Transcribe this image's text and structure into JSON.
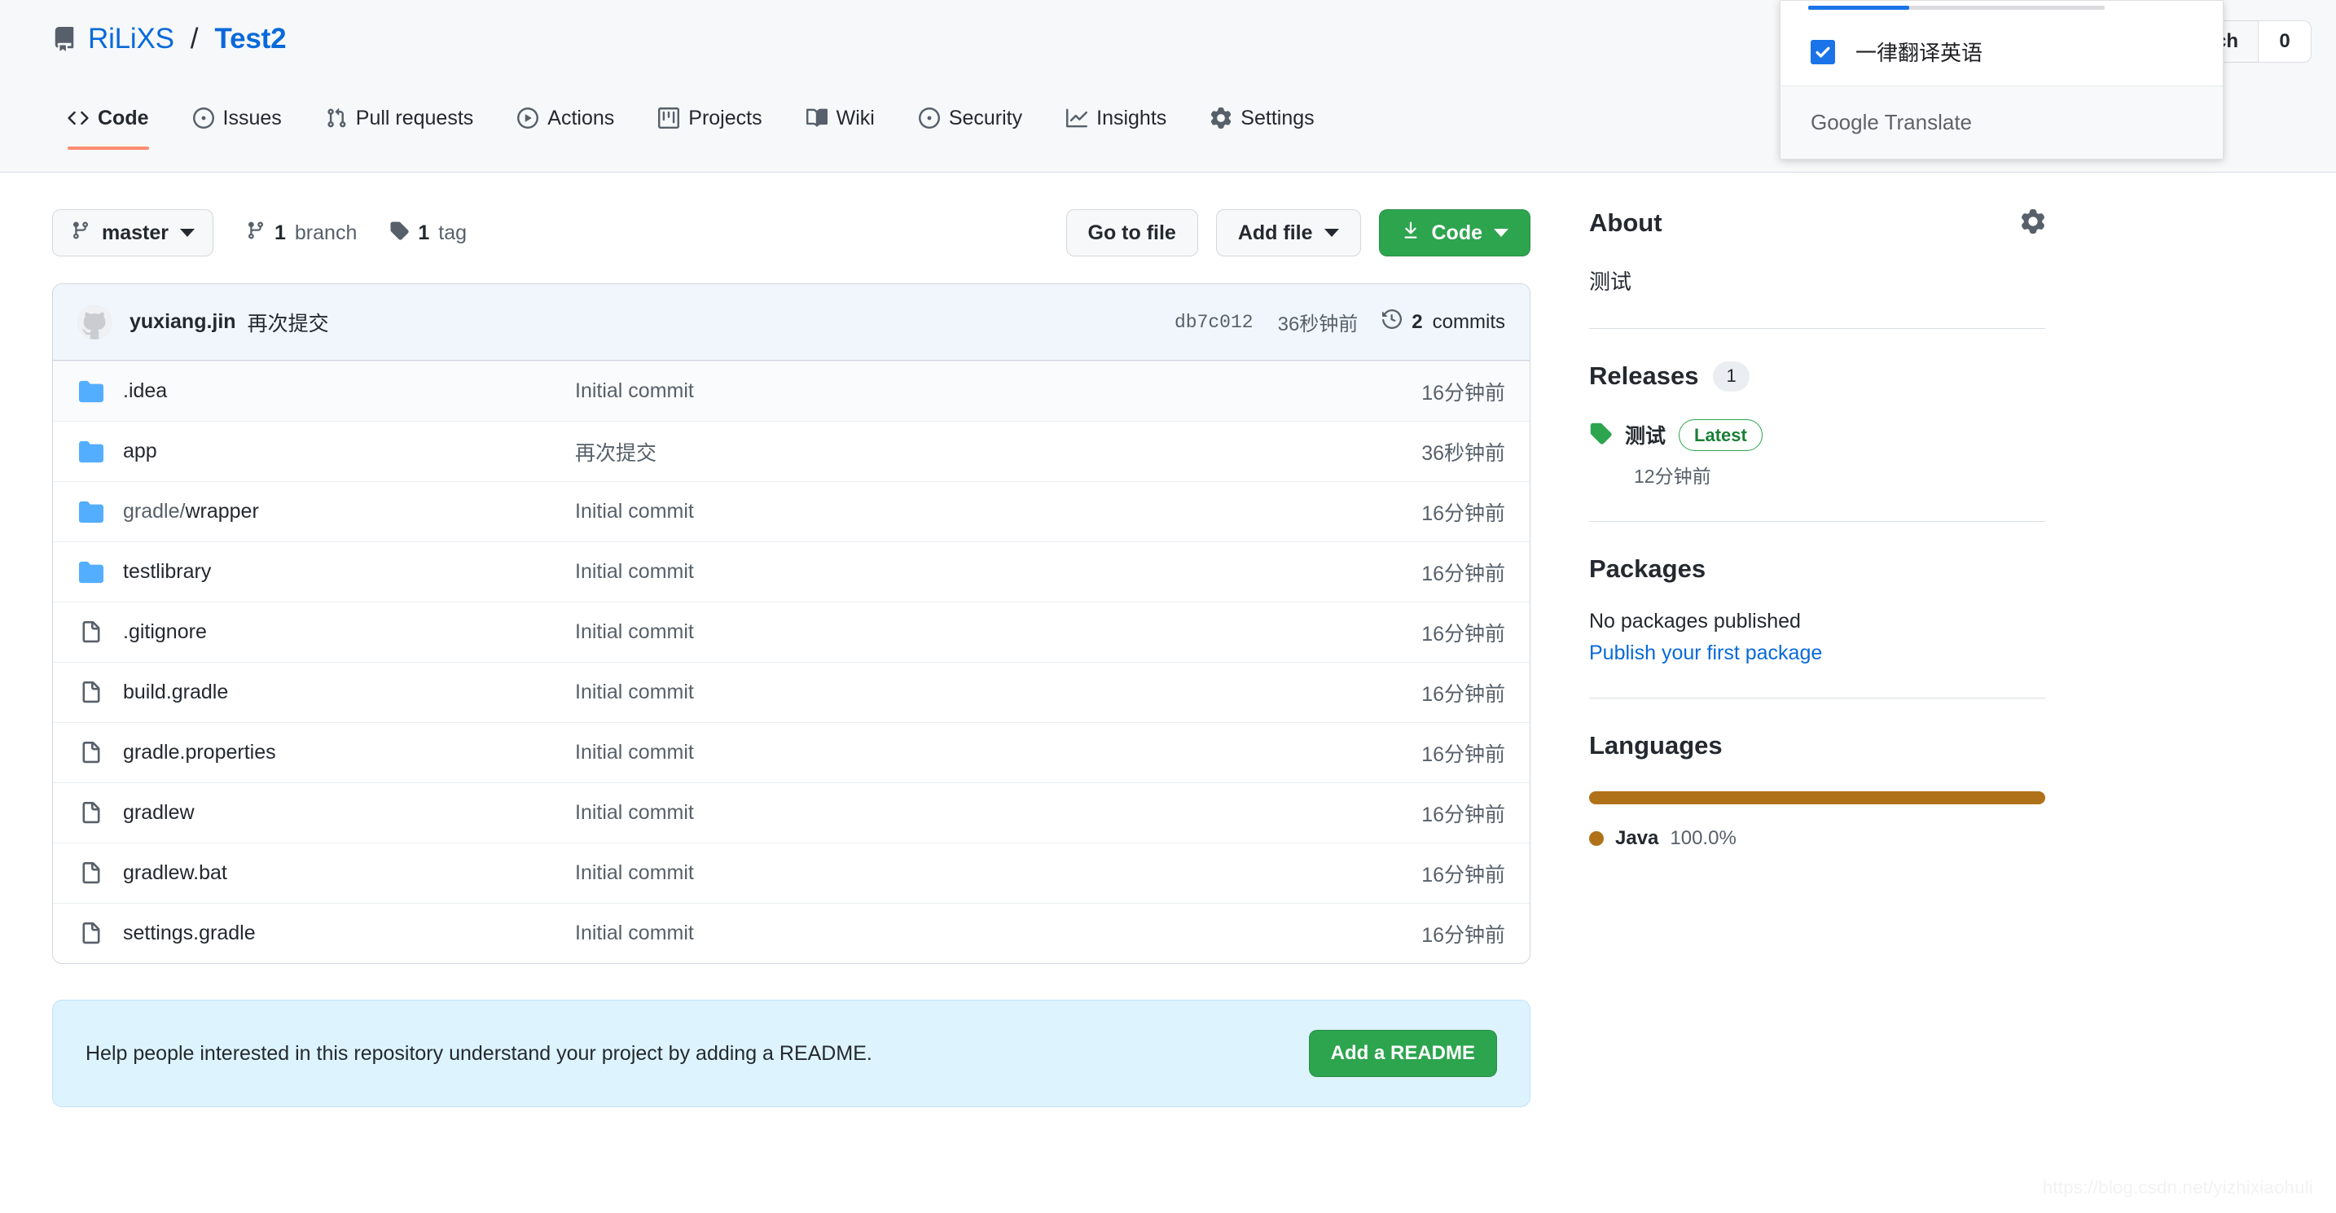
{
  "header": {
    "owner": "RiLiXS",
    "separator": "/",
    "repo": "Test2",
    "watch_label": "Unwatch",
    "watch_count": "0"
  },
  "nav": {
    "tabs": [
      {
        "label": "Code",
        "icon": "code-icon",
        "active": true
      },
      {
        "label": "Issues",
        "icon": "issue-opened-icon",
        "active": false
      },
      {
        "label": "Pull requests",
        "icon": "git-pull-request-icon",
        "active": false
      },
      {
        "label": "Actions",
        "icon": "play-icon",
        "active": false
      },
      {
        "label": "Projects",
        "icon": "project-icon",
        "active": false
      },
      {
        "label": "Wiki",
        "icon": "book-icon",
        "active": false
      },
      {
        "label": "Security",
        "icon": "shield-icon",
        "active": false
      },
      {
        "label": "Insights",
        "icon": "graph-icon",
        "active": false
      },
      {
        "label": "Settings",
        "icon": "gear-icon",
        "active": false
      }
    ]
  },
  "toolbar": {
    "branch": "master",
    "branch_count": "1",
    "branch_word": "branch",
    "tag_count": "1",
    "tag_word": "tag",
    "go_to_file": "Go to file",
    "add_file": "Add file",
    "code": "Code"
  },
  "commit_header": {
    "author": "yuxiang.jin",
    "message": "再次提交",
    "sha": "db7c012",
    "time": "36秒钟前",
    "commits_count": "2",
    "commits_label": "commits"
  },
  "files": [
    {
      "name": ".idea",
      "type": "folder",
      "message": "Initial commit",
      "time": "16分钟前"
    },
    {
      "name": "app",
      "type": "folder",
      "message": "再次提交",
      "time": "36秒钟前"
    },
    {
      "name": "gradle/wrapper",
      "type": "folder",
      "message": "Initial commit",
      "time": "16分钟前",
      "dim_prefix": "gradle/",
      "rest": "wrapper"
    },
    {
      "name": "testlibrary",
      "type": "folder",
      "message": "Initial commit",
      "time": "16分钟前"
    },
    {
      "name": ".gitignore",
      "type": "file",
      "message": "Initial commit",
      "time": "16分钟前"
    },
    {
      "name": "build.gradle",
      "type": "file",
      "message": "Initial commit",
      "time": "16分钟前"
    },
    {
      "name": "gradle.properties",
      "type": "file",
      "message": "Initial commit",
      "time": "16分钟前"
    },
    {
      "name": "gradlew",
      "type": "file",
      "message": "Initial commit",
      "time": "16分钟前"
    },
    {
      "name": "gradlew.bat",
      "type": "file",
      "message": "Initial commit",
      "time": "16分钟前"
    },
    {
      "name": "settings.gradle",
      "type": "file",
      "message": "Initial commit",
      "time": "16分钟前"
    }
  ],
  "readme_banner": {
    "text": "Help people interested in this repository understand your project by adding a README.",
    "button": "Add a README"
  },
  "sidebar": {
    "about": {
      "title": "About",
      "description": "测试"
    },
    "releases": {
      "title": "Releases",
      "count": "1",
      "name": "测试",
      "badge": "Latest",
      "time": "12分钟前"
    },
    "packages": {
      "title": "Packages",
      "empty": "No packages published",
      "link": "Publish your first package"
    },
    "languages": {
      "title": "Languages",
      "items": [
        {
          "name": "Java",
          "percent": "100.0%",
          "color": "#b07219",
          "width": "100%"
        }
      ]
    }
  },
  "translate_popup": {
    "checkbox_label": "一律翻译英语",
    "checked": true,
    "brand_bold": "Google",
    "brand_rest": " Translate",
    "progress_percent": 34
  },
  "watermark": "https://blog.csdn.net/yizhixiaohuli",
  "colors": {
    "accent": "#0969da",
    "green": "#2da44e",
    "tab_underline": "#fd8c73",
    "java": "#b07219",
    "translate_blue": "#1a73e8"
  }
}
